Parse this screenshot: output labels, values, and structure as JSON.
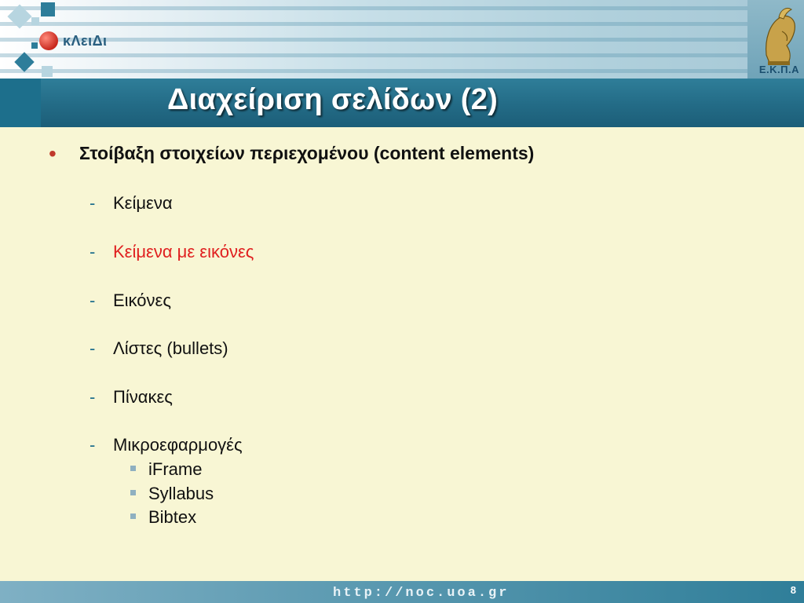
{
  "header": {
    "logo_text": "κΛειΔι",
    "crest_label": "Ε.Κ.Π.Α"
  },
  "title": "Διαχείριση σελίδων (2)",
  "main_bullet": "Στοίβαξη στοιχείων περιεχομένου (content elements)",
  "sub_items": [
    {
      "dash": "-",
      "label": "Κείμενα"
    },
    {
      "dash": "-",
      "label": "Κείμενα με εικόνες",
      "color": "#e02020"
    },
    {
      "dash": "-",
      "label": "Εικόνες"
    },
    {
      "dash": "-",
      "label": "Λίστες (bullets)"
    },
    {
      "dash": "-",
      "label": "Πίνακες"
    },
    {
      "dash": "-",
      "label": "Μικροεφαρμογές"
    }
  ],
  "subsub_items": [
    {
      "label": "iFrame"
    },
    {
      "label": "Syllabus"
    },
    {
      "label": "Bibtex"
    }
  ],
  "footer": {
    "url": "http://noc.uoa.gr",
    "page_number": "8"
  },
  "colors": {
    "background": "#f8f6d4",
    "title_bar": "#236b86",
    "highlight": "#e02020",
    "bullet": "#c0392b"
  }
}
